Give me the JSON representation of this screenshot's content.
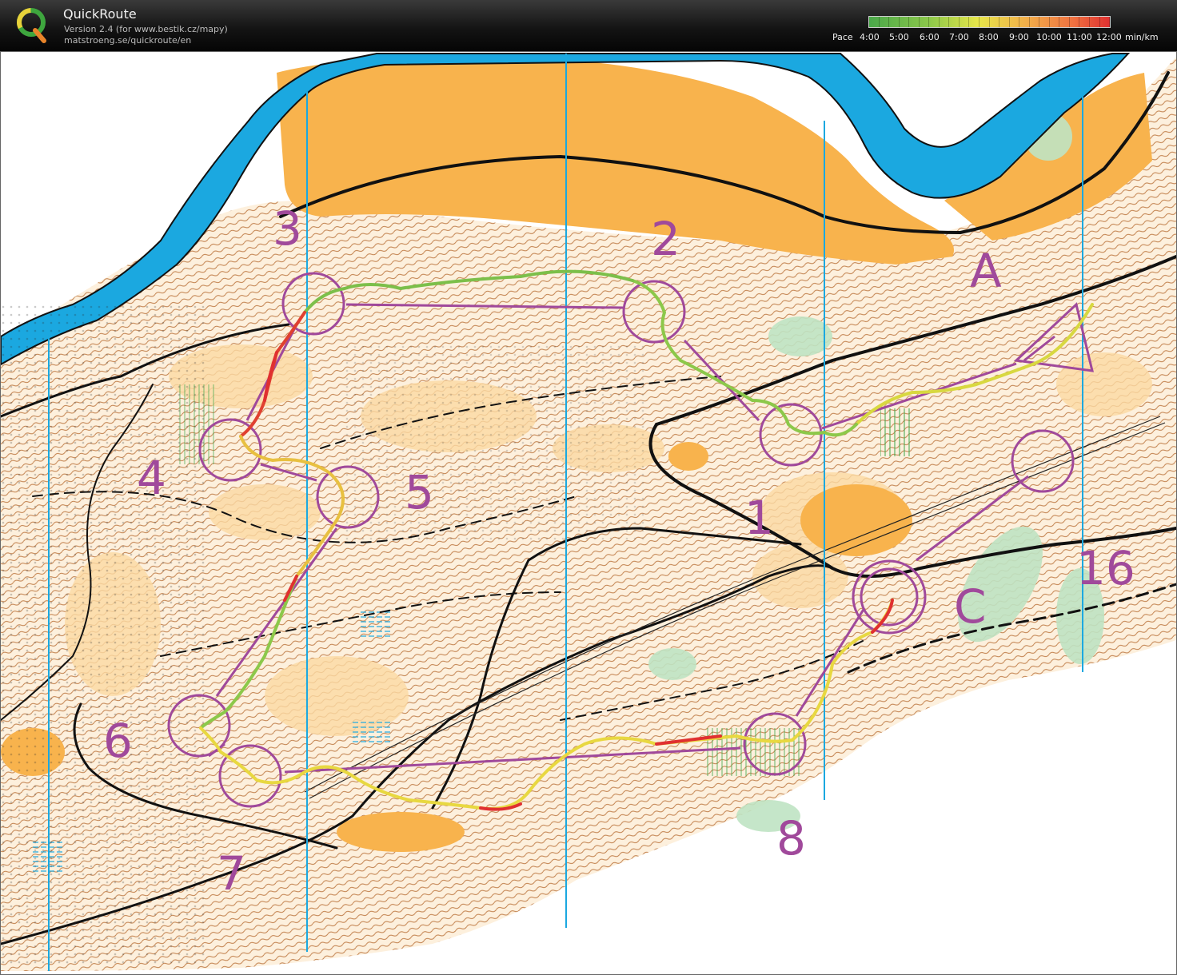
{
  "header": {
    "app_title": "QuickRoute",
    "version": "Version 2.4  (for www.bestik.cz/mapy)",
    "url": "matstroeng.se/quickroute/en",
    "logo_letter": "Q"
  },
  "pace_legend": {
    "label": "Pace",
    "ticks": [
      "4:00",
      "5:00",
      "6:00",
      "7:00",
      "8:00",
      "9:00",
      "10:00",
      "11:00",
      "12:00"
    ],
    "unit": "min/km"
  },
  "map": {
    "controls": [
      {
        "label": "1"
      },
      {
        "label": "2"
      },
      {
        "label": "3"
      },
      {
        "label": "4"
      },
      {
        "label": "5"
      },
      {
        "label": "6"
      },
      {
        "label": "7"
      },
      {
        "label": "8"
      },
      {
        "label": "16"
      },
      {
        "label": "A"
      },
      {
        "label": "C"
      }
    ],
    "colors": {
      "water": "#1ba8e0",
      "open_land": "#f8b34d",
      "rough_open": "#fde3b8",
      "contour": "#b5692e",
      "course": "#a0499b",
      "north_lines": "#1ba8e0",
      "track_fast": "#4aa84a",
      "track_mid": "#e8e040",
      "track_slow": "#e03030"
    }
  }
}
